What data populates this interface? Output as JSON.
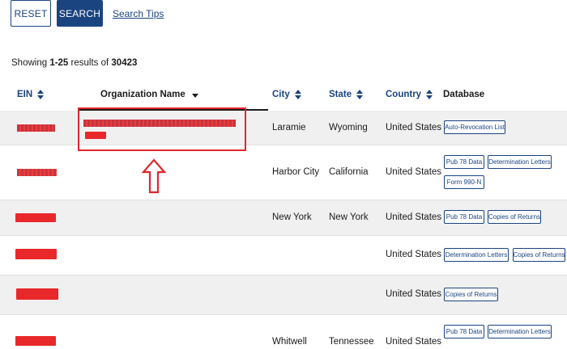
{
  "toolbar": {
    "reset_label": "RESET",
    "search_label": "SEARCH",
    "tips_label": "Search Tips"
  },
  "results": {
    "prefix": "Showing ",
    "range": "1-25",
    "middle": " results of ",
    "total": "30423"
  },
  "columns": {
    "ein": "EIN",
    "org": "Organization Name",
    "city": "City",
    "state": "State",
    "country": "Country",
    "database": "Database"
  },
  "rows": [
    {
      "city": "Laramie",
      "state": "Wyoming",
      "country": "United States",
      "tags": [
        "Auto-Revocation List"
      ]
    },
    {
      "city": "Harbor City",
      "state": "California",
      "country": "United States",
      "tags": [
        "Pub 78 Data",
        "Determination Letters",
        "Form 990-N"
      ]
    },
    {
      "city": "New York",
      "state": "New York",
      "country": "United States",
      "tags": [
        "Pub 78 Data",
        "Copies of Returns"
      ]
    },
    {
      "city": "",
      "state": "",
      "country": "United States",
      "tags": [
        "Determination Letters",
        "Copies of Returns"
      ]
    },
    {
      "city": "",
      "state": "",
      "country": "United States",
      "tags": [
        "Copies of Returns"
      ]
    },
    {
      "city": "Whitwell",
      "state": "Tennessee",
      "country": "United States",
      "tags": [
        "Pub 78 Data",
        "Determination Letters"
      ]
    }
  ],
  "colors": {
    "primary": "#1a4480",
    "annotation_red": "#e3262b",
    "row_alt": "#f0f0f0"
  }
}
